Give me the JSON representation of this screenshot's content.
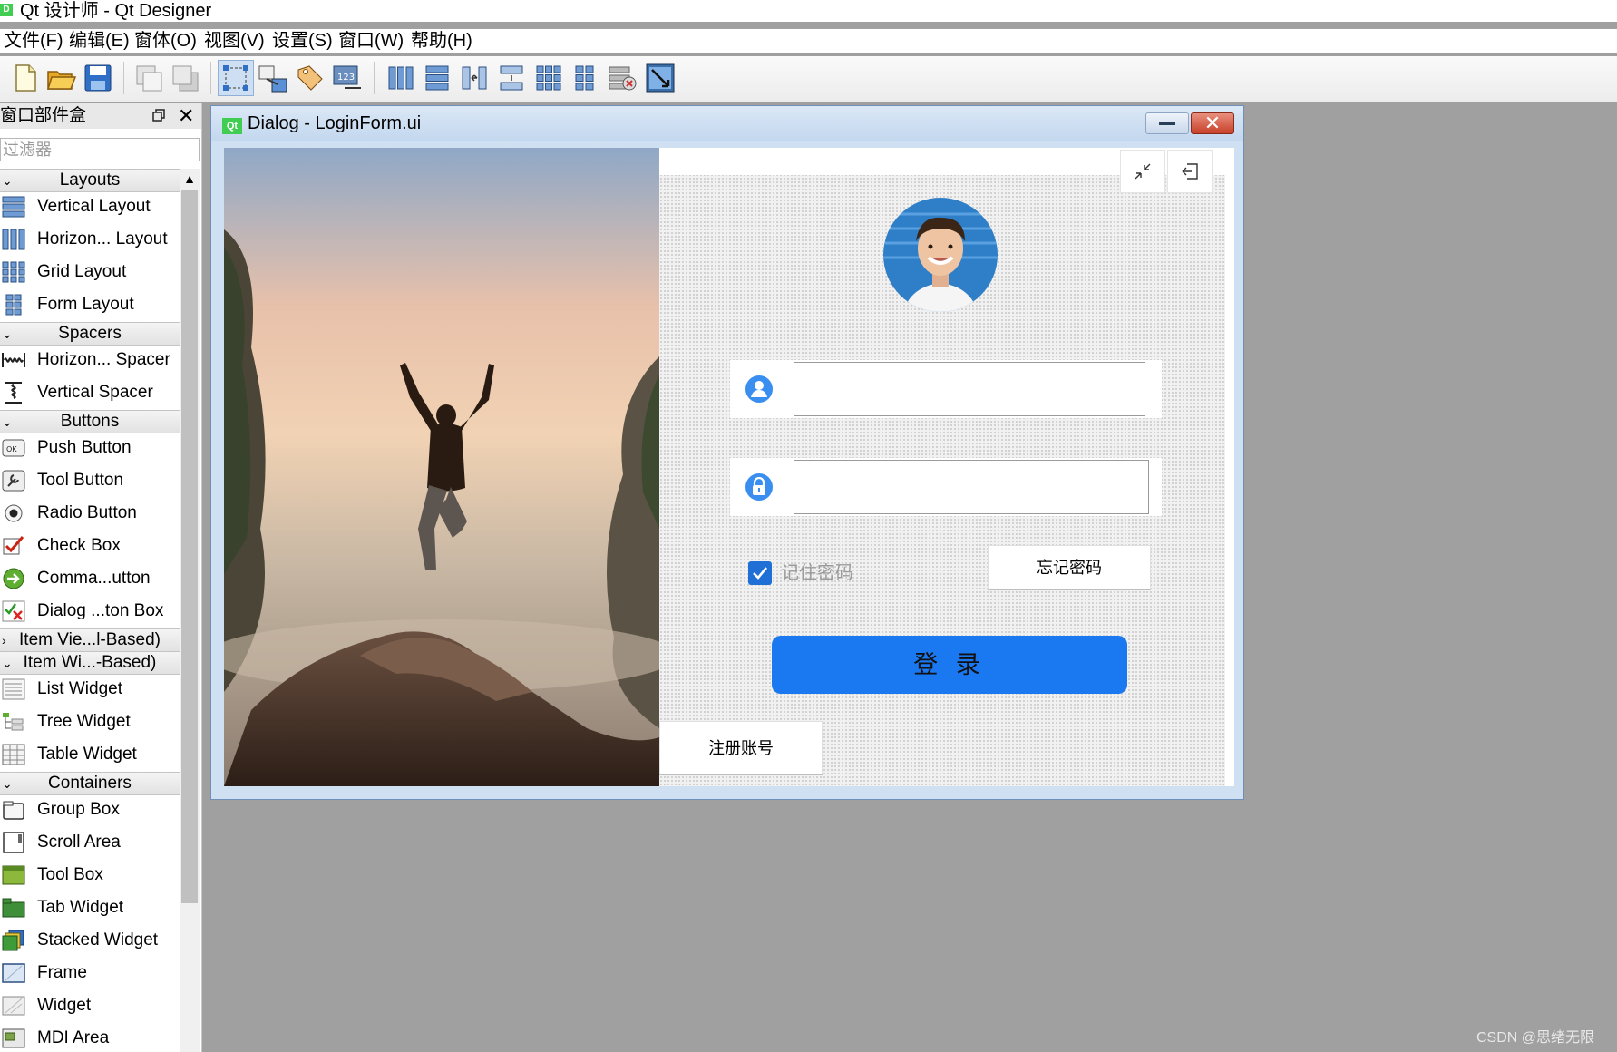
{
  "window": {
    "app_icon_text": "D",
    "title": "Qt 设计师 - Qt Designer"
  },
  "menubar": [
    "文件(F)",
    "编辑(E)",
    "窗体(O)",
    "视图(V)",
    "设置(S)",
    "窗口(W)",
    "帮助(H)"
  ],
  "toolbar": [
    {
      "name": "new-form-icon",
      "pressed": false
    },
    {
      "name": "open-icon",
      "pressed": false
    },
    {
      "name": "save-icon",
      "pressed": false
    },
    {
      "name": "send-to-back-icon",
      "pressed": false
    },
    {
      "name": "bring-to-front-icon",
      "pressed": false
    },
    {
      "name": "edit-widgets-icon",
      "pressed": true
    },
    {
      "name": "edit-signals-slots-icon",
      "pressed": false
    },
    {
      "name": "edit-buddies-icon",
      "pressed": false
    },
    {
      "name": "edit-tab-order-icon",
      "pressed": false
    },
    {
      "name": "layout-horizontal-icon",
      "pressed": false
    },
    {
      "name": "layout-vertical-icon",
      "pressed": false
    },
    {
      "name": "layout-horizontal-splitter-icon",
      "pressed": false
    },
    {
      "name": "layout-vertical-splitter-icon",
      "pressed": false
    },
    {
      "name": "layout-grid-icon",
      "pressed": false
    },
    {
      "name": "layout-form-icon",
      "pressed": false
    },
    {
      "name": "break-layout-icon",
      "pressed": false
    },
    {
      "name": "adjust-size-icon",
      "pressed": false
    }
  ],
  "widget_box": {
    "title": "窗口部件盒",
    "filter_placeholder": "过滤器",
    "categories": [
      {
        "label": "Layouts",
        "expanded": true,
        "items": [
          {
            "label": "Vertical Layout",
            "icon": "vertical-layout-icon"
          },
          {
            "label": "Horizon... Layout",
            "icon": "horizontal-layout-icon"
          },
          {
            "label": "Grid Layout",
            "icon": "grid-layout-icon"
          },
          {
            "label": "Form Layout",
            "icon": "form-layout-icon"
          }
        ]
      },
      {
        "label": "Spacers",
        "expanded": true,
        "items": [
          {
            "label": "Horizon... Spacer",
            "icon": "horizontal-spacer-icon"
          },
          {
            "label": "Vertical Spacer",
            "icon": "vertical-spacer-icon"
          }
        ]
      },
      {
        "label": "Buttons",
        "expanded": true,
        "items": [
          {
            "label": "Push Button",
            "icon": "push-button-icon"
          },
          {
            "label": "Tool Button",
            "icon": "tool-button-icon"
          },
          {
            "label": "Radio Button",
            "icon": "radio-button-icon"
          },
          {
            "label": "Check Box",
            "icon": "check-box-icon"
          },
          {
            "label": "Comma...utton",
            "icon": "command-link-button-icon"
          },
          {
            "label": "Dialog ...ton Box",
            "icon": "dialog-button-box-icon"
          }
        ]
      },
      {
        "label": "Item Vie...l-Based)",
        "expanded": false,
        "items": []
      },
      {
        "label": "Item Wi...-Based)",
        "expanded": true,
        "items": [
          {
            "label": "List Widget",
            "icon": "list-widget-icon"
          },
          {
            "label": "Tree Widget",
            "icon": "tree-widget-icon"
          },
          {
            "label": "Table Widget",
            "icon": "table-widget-icon"
          }
        ]
      },
      {
        "label": "Containers",
        "expanded": true,
        "items": [
          {
            "label": "Group Box",
            "icon": "group-box-icon"
          },
          {
            "label": "Scroll Area",
            "icon": "scroll-area-icon"
          },
          {
            "label": "Tool Box",
            "icon": "tool-box-icon"
          },
          {
            "label": "Tab Widget",
            "icon": "tab-widget-icon"
          },
          {
            "label": "Stacked Widget",
            "icon": "stacked-widget-icon"
          },
          {
            "label": "Frame",
            "icon": "frame-icon"
          },
          {
            "label": "Widget",
            "icon": "widget-icon"
          },
          {
            "label": "MDI Area",
            "icon": "mdi-area-icon"
          }
        ]
      }
    ]
  },
  "dialog": {
    "qt_icon_text": "Qt",
    "title": "Dialog - LoginForm.ui",
    "close_glyph": "✕",
    "form": {
      "username_value": "",
      "password_value": "",
      "remember_label": "记住密码",
      "remember_checked": true,
      "forgot_label": "忘记密码",
      "login_label": "登 录",
      "register_label": "注册账号"
    }
  },
  "colors": {
    "accent": "#1a78f0",
    "check": "#1f6fd6",
    "mdi_background": "#a0a0a0"
  },
  "watermark": "CSDN @思绪无限"
}
